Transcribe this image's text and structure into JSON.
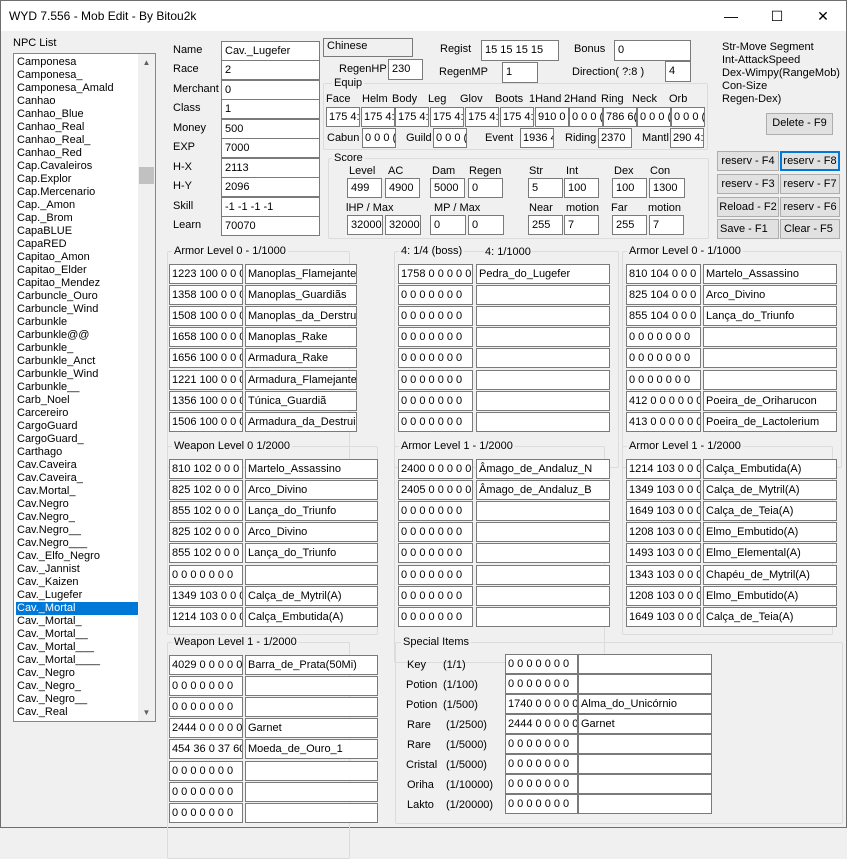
{
  "window": {
    "title": "WYD 7.556 - Mob Edit - By Bitou2k",
    "minimize": "—",
    "maximize": "☐",
    "close": "✕"
  },
  "npc_list": {
    "label": "NPC List",
    "selected_index": 42,
    "items": [
      "Camponesa",
      "Camponesa_",
      "Camponesa_Amald",
      "Canhao",
      "Canhao_Blue",
      "Canhao_Real",
      "Canhao_Real_",
      "Canhao_Red",
      "Cap.Cavaleiros",
      "Cap.Explor",
      "Cap.Mercenario",
      "Cap._Amon",
      "Cap._Brom",
      "CapaBLUE",
      "CapaRED",
      "Capitao_Amon",
      "Capitao_Elder",
      "Capitao_Mendez",
      "Carbuncle_Ouro",
      "Carbuncle_Wind",
      "Carbunkle",
      "Carbunkle@@",
      "Carbunkle_",
      "Carbunkle_Anct",
      "Carbunkle_Wind",
      "Carbunkle__",
      "Carb_Noel",
      "Carcereiro",
      "CargoGuard",
      "CargoGuard_",
      "Carthago",
      "Cav.Caveira",
      "Cav.Caveira_",
      "Cav.Mortal_",
      "Cav.Negro",
      "Cav.Negro_",
      "Cav.Negro__",
      "Cav.Negro___",
      "Cav._Elfo_Negro",
      "Cav._Jannist",
      "Cav._Kaizen",
      "Cav._Lugefer",
      "Cav._Mortal",
      "Cav._Mortal_",
      "Cav._Mortal__",
      "Cav._Mortal___",
      "Cav._Mortal____",
      "Cav._Negro",
      "Cav._Negro_",
      "Cav._Negro__",
      "Cav._Real"
    ]
  },
  "basic": {
    "name": {
      "label": "Name",
      "value": "Cav._Lugefer"
    },
    "race": {
      "label": "Race",
      "value": "2"
    },
    "merchant": {
      "label": "Merchant",
      "value": "0"
    },
    "class": {
      "label": "Class",
      "value": "1"
    },
    "money": {
      "label": "Money",
      "value": "500"
    },
    "exp": {
      "label": "EXP",
      "value": "7000"
    },
    "hx": {
      "label": "H-X",
      "value": "2113"
    },
    "hy": {
      "label": "H-Y",
      "value": "2096"
    },
    "skill": {
      "label": "Skill",
      "value": "-1 -1 -1 -1"
    },
    "learn": {
      "label": "Learn",
      "value": "70070"
    }
  },
  "top": {
    "language": "Chinese",
    "regist": {
      "label": "Regist",
      "value": "15 15 15 15"
    },
    "bonus": {
      "label": "Bonus",
      "value": "0"
    },
    "regenhp": {
      "label": "RegenHP",
      "value": "230"
    },
    "regenmp": {
      "label": "RegenMP",
      "value": "1"
    },
    "direction": {
      "label": "Direction( ?:8 )",
      "value": "4"
    }
  },
  "notes": [
    "Str-Move Segment",
    "Int-AttackSpeed",
    "Dex-Wimpy(RangeMob)",
    "Con-Size",
    "Regen-Dex)"
  ],
  "equip": {
    "label": "Equip",
    "headers": [
      "Face",
      "Helm",
      "Body",
      "Leg",
      "Glov",
      "Boots",
      "1Hand",
      "2Hand",
      "Ring",
      "Neck",
      "Orb"
    ],
    "values": [
      "175 4:",
      "175 4:",
      "175 4:",
      "175 4:",
      "175 4:",
      "175 4:",
      "910 0",
      "0 0 0 (",
      "786 6(",
      "0 0 0 (",
      "0 0 0 ("
    ],
    "extra": [
      {
        "label": "Cabun",
        "value": "0 0 0 ("
      },
      {
        "label": "Guild",
        "value": "0 0 0 ("
      },
      {
        "label": "Event",
        "value": "1936 4"
      },
      {
        "label": "Riding",
        "value": "2370"
      },
      {
        "label": "Mantl",
        "value": "290 4:"
      }
    ]
  },
  "score": {
    "label": "Score",
    "level": {
      "label": "Level",
      "value": "499"
    },
    "ac": {
      "label": "AC",
      "value": "4900"
    },
    "dam": {
      "label": "Dam",
      "value": "5000"
    },
    "regen": {
      "label": "Regen",
      "value": "0"
    },
    "str": {
      "label": "Str",
      "value": "5"
    },
    "int": {
      "label": "Int",
      "value": "100"
    },
    "dex": {
      "label": "Dex",
      "value": "100"
    },
    "con": {
      "label": "Con",
      "value": "1300"
    },
    "hp_label": "lHP / Max",
    "hp": "32000",
    "hpmax": "32000",
    "mp_label": "MP / Max",
    "mp": "0",
    "mpmax": "0",
    "near": {
      "label": "Near",
      "value": "255"
    },
    "motion1": {
      "label": "motion",
      "value": "7"
    },
    "far": {
      "label": "Far",
      "value": "255"
    },
    "motion2": {
      "label": "motion",
      "value": "7"
    }
  },
  "buttons": {
    "delete": "Delete - F9",
    "f4": "reserv - F4",
    "f8": "reserv - F8",
    "f3": "reserv - F3",
    "f7": "reserv - F7",
    "reload": "Reload - F2",
    "f6": "reserv - F6",
    "save": "Save     - F1",
    "clear": "Clear   - F5"
  },
  "groups": [
    {
      "title": "Armor Level 0 - 1/1000",
      "rows": [
        [
          "1223 100 0 0 0",
          "Manoplas_Flamejantes"
        ],
        [
          "1358 100 0 0 0",
          "Manoplas_Guardiãs"
        ],
        [
          "1508 100 0 0 0",
          "Manoplas_da_Derstruição"
        ],
        [
          "1658 100 0 0 0",
          "Manoplas_Rake"
        ],
        [
          "1656 100 0 0 0",
          "Armadura_Rake"
        ],
        [
          "1221 100 0 0 0",
          "Armadura_Flamejante"
        ],
        [
          "1356 100 0 0 0",
          "Túnica_Guardiã"
        ],
        [
          "1506 100 0 0 0",
          "Armadura_da_Destruição"
        ]
      ]
    },
    {
      "title": "4: 1/4 (boss)",
      "title2": "4: 1/1000",
      "rows": [
        [
          "1758 0 0 0 0 0",
          "Pedra_do_Lugefer"
        ],
        [
          "0 0 0 0 0 0 0",
          ""
        ],
        [
          "0 0 0 0 0 0 0",
          ""
        ],
        [
          "0 0 0 0 0 0 0",
          ""
        ],
        [
          "0 0 0 0 0 0 0",
          ""
        ],
        [
          "0 0 0 0 0 0 0",
          ""
        ],
        [
          "0 0 0 0 0 0 0",
          ""
        ],
        [
          "0 0 0 0 0 0 0",
          ""
        ]
      ]
    },
    {
      "title": "Armor Level 0 - 1/1000",
      "rows": [
        [
          "810 104 0 0 0",
          "Martelo_Assassino"
        ],
        [
          "825 104 0 0 0",
          "Arco_Divino"
        ],
        [
          "855 104 0 0 0",
          "Lança_do_Triunfo"
        ],
        [
          "0 0 0 0 0 0 0",
          ""
        ],
        [
          "0 0 0 0 0 0 0",
          ""
        ],
        [
          "0 0 0 0 0 0 0",
          ""
        ],
        [
          "412 0 0 0 0 0 0",
          "Poeira_de_Oriharucon"
        ],
        [
          "413 0 0 0 0 0 0",
          "Poeira_de_Lactolerium"
        ]
      ]
    },
    {
      "title": "Weapon Level 0 1/2000",
      "rows": [
        [
          "810 102 0 0 0",
          "Martelo_Assassino"
        ],
        [
          "825 102 0 0 0",
          "Arco_Divino"
        ],
        [
          "855 102 0 0 0",
          "Lança_do_Triunfo"
        ],
        [
          "825 102 0 0 0",
          "Arco_Divino"
        ],
        [
          "855 102 0 0 0",
          "Lança_do_Triunfo"
        ],
        [
          "0 0 0 0 0 0 0",
          ""
        ],
        [
          "1349 103 0 0 0",
          "Calça_de_Mytril(A)"
        ],
        [
          "1214 103 0 0 0",
          "Calça_Embutida(A)"
        ]
      ]
    },
    {
      "title": "Armor Level 1 - 1/2000",
      "rows": [
        [
          "2400 0 0 0 0 0",
          "Âmago_de_Andaluz_N"
        ],
        [
          "2405 0 0 0 0 0",
          "Âmago_de_Andaluz_B"
        ],
        [
          "0 0 0 0 0 0 0",
          ""
        ],
        [
          "0 0 0 0 0 0 0",
          ""
        ],
        [
          "0 0 0 0 0 0 0",
          ""
        ],
        [
          "0 0 0 0 0 0 0",
          ""
        ],
        [
          "0 0 0 0 0 0 0",
          ""
        ],
        [
          "0 0 0 0 0 0 0",
          ""
        ]
      ]
    },
    {
      "title": "Armor Level 1 - 1/2000",
      "rows": [
        [
          "1214 103 0 0 0",
          "Calça_Embutida(A)"
        ],
        [
          "1349 103 0 0 0",
          "Calça_de_Mytril(A)"
        ],
        [
          "1649 103 0 0 0",
          "Calça_de_Teia(A)"
        ],
        [
          "1208 103 0 0 0",
          "Elmo_Embutido(A)"
        ],
        [
          "1493 103 0 0 0",
          "Elmo_Elemental(A)"
        ],
        [
          "1343 103 0 0 0",
          "Chapéu_de_Mytril(A)"
        ],
        [
          "1208 103 0 0 0",
          "Elmo_Embutido(A)"
        ],
        [
          "1649 103 0 0 0",
          "Calça_de_Teia(A)"
        ]
      ]
    },
    {
      "title": "Weapon Level 1 - 1/2000",
      "rows": [
        [
          "4029 0 0 0 0 0",
          "Barra_de_Prata(50Mi)"
        ],
        [
          "0 0 0 0 0 0 0",
          ""
        ],
        [
          "0 0 0 0 0 0 0",
          ""
        ],
        [
          "2444 0 0 0 0 0",
          "Garnet"
        ],
        [
          "454 36 0 37 60",
          "Moeda_de_Ouro_1"
        ],
        [
          "0 0 0 0 0 0 0",
          ""
        ],
        [
          "0 0 0 0 0 0 0",
          ""
        ],
        [
          "0 0 0 0 0 0 0",
          ""
        ]
      ]
    }
  ],
  "special": {
    "title": "Special Items",
    "rows": [
      {
        "label": "Key",
        "rate": "(1/1)",
        "code": "0 0 0 0 0 0 0",
        "name": ""
      },
      {
        "label": "Potion",
        "rate": "(1/100)",
        "code": "0 0 0 0 0 0 0",
        "name": ""
      },
      {
        "label": "Potion",
        "rate": "(1/500)",
        "code": "1740 0 0 0 0 0",
        "name": "Alma_do_Unicórnio"
      },
      {
        "label": "Rare",
        "rate": "(1/2500)",
        "code": "2444 0 0 0 0 0",
        "name": "Garnet"
      },
      {
        "label": "Rare",
        "rate": "(1/5000)",
        "code": "0 0 0 0 0 0 0",
        "name": ""
      },
      {
        "label": "Cristal",
        "rate": "(1/5000)",
        "code": "0 0 0 0 0 0 0",
        "name": ""
      },
      {
        "label": "Oriha",
        "rate": "(1/10000)",
        "code": "0 0 0 0 0 0 0",
        "name": ""
      },
      {
        "label": "Lakto",
        "rate": "(1/20000)",
        "code": "0 0 0 0 0 0 0",
        "name": ""
      }
    ]
  }
}
